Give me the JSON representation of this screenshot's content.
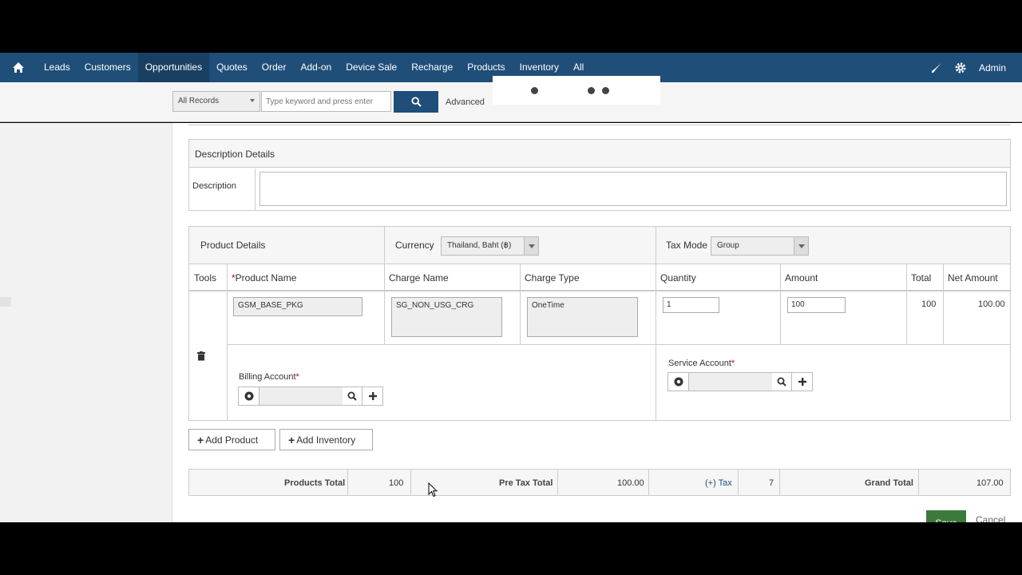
{
  "nav": {
    "items": [
      "Leads",
      "Customers",
      "Opportunities",
      "Quotes",
      "Order",
      "Add-on",
      "Device Sale",
      "Recharge",
      "Products",
      "Inventory",
      "All"
    ],
    "active": "Opportunities",
    "admin_label": "Admin"
  },
  "search": {
    "scope": "All Records",
    "placeholder": "Type keyword and press enter",
    "advanced_label": "Advanced"
  },
  "description": {
    "section_title": "Description Details",
    "field_label": "Description",
    "value": ""
  },
  "products": {
    "section_title": "Product Details",
    "currency_label": "Currency",
    "currency_value": "Thailand, Baht (฿)",
    "tax_mode_label": "Tax Mode",
    "tax_mode_value": "Group",
    "columns": {
      "tools": "Tools",
      "product_name": "Product Name",
      "charge_name": "Charge Name",
      "charge_type": "Charge Type",
      "quantity": "Quantity",
      "amount": "Amount",
      "total": "Total",
      "net_amount": "Net Amount"
    },
    "row": {
      "product_name": "GSM_BASE_PKG",
      "charge_name": "SG_NON_USG_CRG",
      "charge_type": "OneTime",
      "quantity": "1",
      "amount": "100",
      "total": "100",
      "net_amount": "100.00"
    },
    "billing_account_label": "Billing Account",
    "service_account_label": "Service Account"
  },
  "actions": {
    "add_product": "Add Product",
    "add_inventory": "Add Inventory",
    "save": "Save",
    "cancel": "Cancel"
  },
  "totals": {
    "products_total_label": "Products Total",
    "products_total": "100",
    "pre_tax_label": "Pre Tax Total",
    "pre_tax_total": "100.00",
    "tax_label": "(+) Tax",
    "tax_value": "7",
    "grand_total_label": "Grand Total",
    "grand_total": "107.00"
  },
  "colors": {
    "nav_bg": "#1f4e79",
    "save_bg": "#3b7a3b"
  }
}
